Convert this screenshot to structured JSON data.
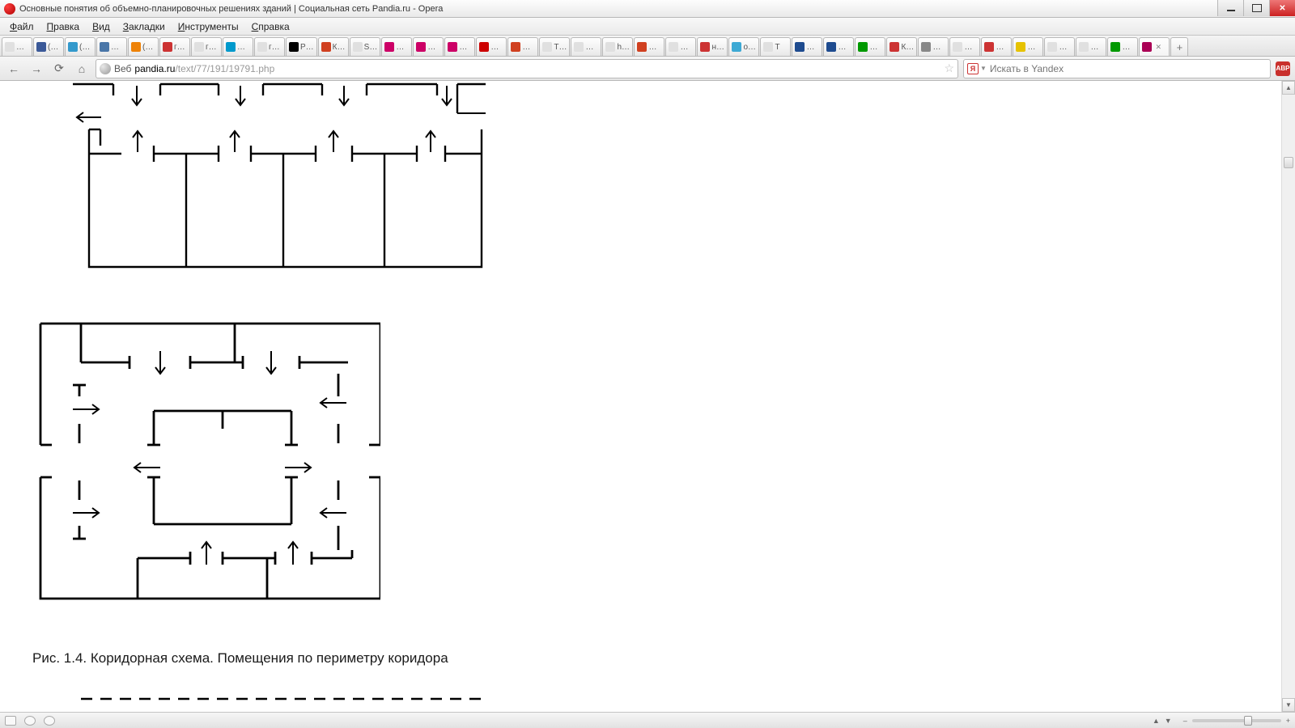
{
  "window": {
    "title": "Основные понятия об объемно-планировочных решениях зданий | Социальная сеть Pandia.ru - Opera"
  },
  "menu": {
    "file": {
      "u": "Ф",
      "rest": "айл"
    },
    "edit": {
      "u": "П",
      "rest": "равка"
    },
    "view": {
      "u": "В",
      "rest": "ид"
    },
    "bookmarks": {
      "u": "З",
      "rest": "акладки"
    },
    "tools": {
      "u": "И",
      "rest": "нструменты"
    },
    "help": {
      "u": "С",
      "rest": "правка"
    }
  },
  "tabs": [
    {
      "label": "…",
      "fav": "#e0e0e0"
    },
    {
      "label": "(…",
      "fav": "#3b5998"
    },
    {
      "label": "(…",
      "fav": "#39c"
    },
    {
      "label": "…",
      "fav": "#4a76a8"
    },
    {
      "label": "(…",
      "fav": "#ee8208"
    },
    {
      "label": "г…",
      "fav": "#c33"
    },
    {
      "label": "г…",
      "fav": "#e0e0e0"
    },
    {
      "label": "…",
      "fav": "#09c"
    },
    {
      "label": "г…",
      "fav": "#e0e0e0"
    },
    {
      "label": "P…",
      "fav": "#000"
    },
    {
      "label": "К…",
      "fav": "#d04020"
    },
    {
      "label": "S…",
      "fav": "#e0e0e0"
    },
    {
      "label": "…",
      "fav": "#c06"
    },
    {
      "label": "…",
      "fav": "#c06"
    },
    {
      "label": "…",
      "fav": "#c06"
    },
    {
      "label": "…",
      "fav": "#c00"
    },
    {
      "label": "…",
      "fav": "#d04020"
    },
    {
      "label": "T…",
      "fav": "#e0e0e0"
    },
    {
      "label": "…",
      "fav": "#e0e0e0"
    },
    {
      "label": "h…",
      "fav": "#e0e0e0"
    },
    {
      "label": "…",
      "fav": "#d04020"
    },
    {
      "label": "…",
      "fav": "#e0e0e0"
    },
    {
      "label": "н…",
      "fav": "#c33"
    },
    {
      "label": "o…",
      "fav": "#3da9d4"
    },
    {
      "label": "T",
      "fav": "#e0e0e0"
    },
    {
      "label": "…",
      "fav": "#1e4b8f"
    },
    {
      "label": "…",
      "fav": "#1e4b8f"
    },
    {
      "label": "…",
      "fav": "#090"
    },
    {
      "label": "К…",
      "fav": "#c33"
    },
    {
      "label": "…",
      "fav": "#888"
    },
    {
      "label": "…",
      "fav": "#e0e0e0"
    },
    {
      "label": "…",
      "fav": "#c33"
    },
    {
      "label": "…",
      "fav": "#e6c200"
    },
    {
      "label": "…",
      "fav": "#e0e0e0"
    },
    {
      "label": "…",
      "fav": "#e0e0e0"
    },
    {
      "label": "…",
      "fav": "#090"
    },
    {
      "label": "",
      "fav": "#a05",
      "active": true,
      "closable": true
    }
  ],
  "address": {
    "protocol_label": "Веб",
    "host": "pandia.ru",
    "path": "/text/77/191/19791.php"
  },
  "search": {
    "engine_glyph": "Я",
    "placeholder": "Искать в Yandex"
  },
  "abp": {
    "label": "ABP"
  },
  "caption": "Рис. 1.4. Коридорная схема. Помещения по периметру коридора"
}
